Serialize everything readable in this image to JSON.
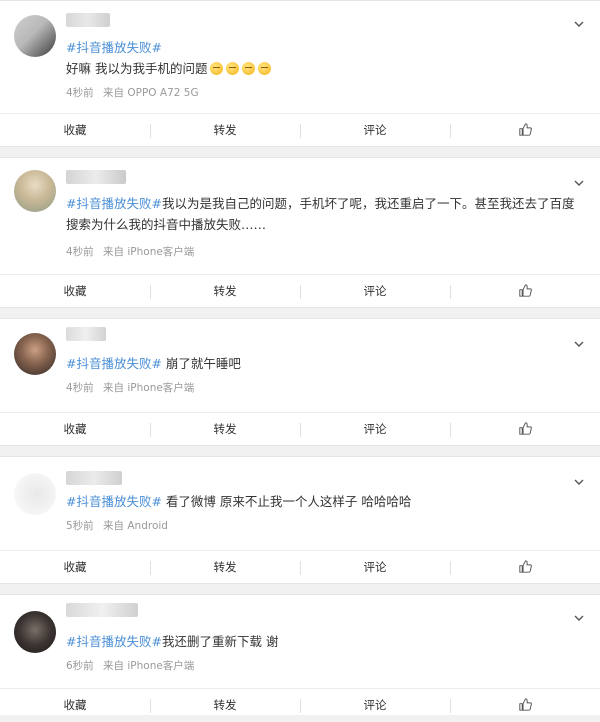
{
  "posts": [
    {
      "hashtag": "#抖音播放失败#",
      "text": " 好嘛 我以为我手机的问题",
      "emojis": [
        "face-emoji",
        "face-emoji",
        "face-emoji",
        "face-emoji"
      ],
      "time": "4秒前",
      "source": "来自 OPPO A72 5G"
    },
    {
      "hashtag": "#抖音播放失败#",
      "text": "我以为是我自己的问题，手机坏了呢，我还重启了一下。甚至我还去了百度搜索为什么我的抖音中播放失败……",
      "time": "4秒前",
      "source": "来自 iPhone客户端"
    },
    {
      "hashtag": "#抖音播放失败#",
      "text": " 崩了就午睡吧",
      "time": "4秒前",
      "source": "来自 iPhone客户端"
    },
    {
      "hashtag": "#抖音播放失败#",
      "text": " 看了微博 原来不止我一个人这样子 哈哈哈哈",
      "time": "5秒前",
      "source": "来自 Android"
    },
    {
      "hashtag": "#抖音播放失败#",
      "text": "我还删了重新下载 谢",
      "time": "6秒前",
      "source": "来自 iPhone客户端"
    }
  ],
  "actions": {
    "favorite": "收藏",
    "repost": "转发",
    "comment": "评论"
  },
  "icons": {
    "like": "thumbs-up-icon",
    "menu": "chevron-down-icon"
  },
  "colors": {
    "hashtag": "#4b8fd6",
    "meta": "#9a9a9a",
    "background": "#f1f1f1"
  }
}
